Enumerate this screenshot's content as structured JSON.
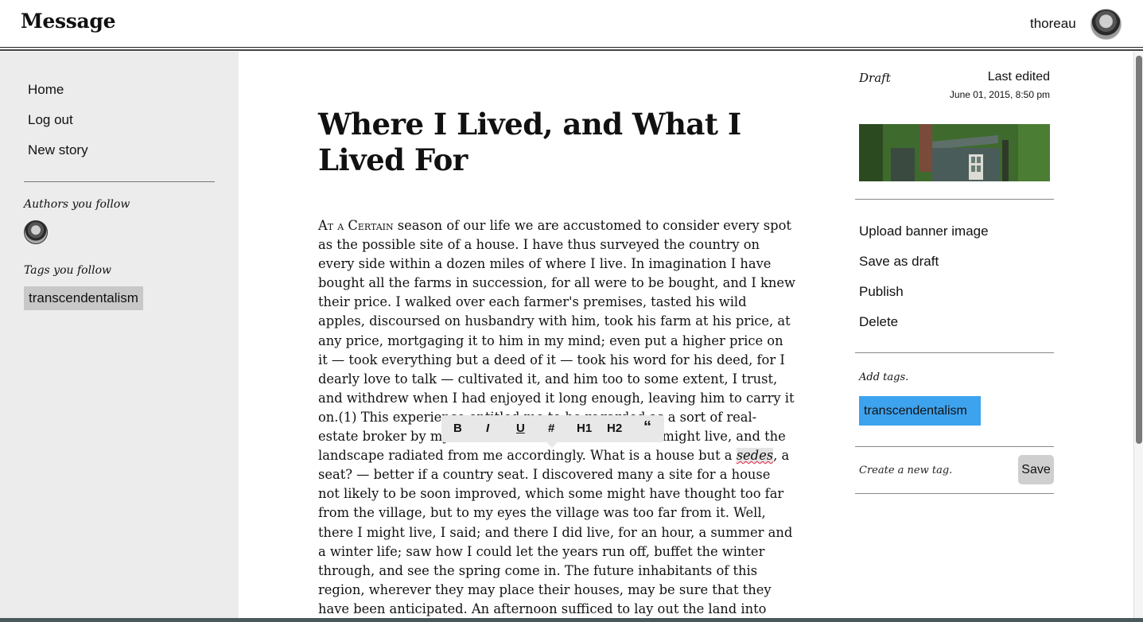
{
  "app": {
    "brand": "Message"
  },
  "user": {
    "name": "thoreau"
  },
  "sidebar": {
    "nav": [
      {
        "label": "Home"
      },
      {
        "label": "Log out"
      },
      {
        "label": "New story"
      }
    ],
    "authors_heading": "Authors you follow",
    "tags_heading": "Tags you follow",
    "tags": [
      {
        "label": "transcendentalism"
      }
    ]
  },
  "article": {
    "title": "Where I Lived, and What I Lived For",
    "body_lead_smallcaps": "At a Certain",
    "body_part1": " season of our life we are accustomed to consider every spot as the possible site of a house. I have thus surveyed the country on every side within a dozen miles of where I live. In imagination I have bought all the farms in succession, for all were to be bought, and I knew their price. I walked over each farmer's premises, tasted his wild apples, discoursed on husbandry with him, took his farm at his price, at any price, mortgaging it to him in my mind; even put a higher price on it — took everything but a deed of it — took his word for his deed, for I dearly love to talk — cultivated it, and him too to some extent, I trust, and withdrew when I had enjoyed it long enough, leaving him to carry it on.(1) This experience entitled me to be regarded as a sort of real-estate broker by my friends. Wherever I sat, there I might live, and the landscape radiated from me accordingly. What is a house but a ",
    "body_italic": "sedes",
    "body_part2": ", a seat? — better if a country seat. I discovered many a site for a house not likely to be soon improved, which some might have thought too far from the village, but to my eyes the village was too far from it. Well, there I might live, I said; and there I did live, for an hour, a summer and a winter life; saw how I could let the years run off, buffet the winter through, and see the spring come in. The future inhabitants of this region, wherever they may place their houses, may be sure that they have been anticipated. An afternoon sufficed to lay out the land into orchard, wood-lot, and pasture, and to decide what fine oaks or"
  },
  "toolbar": {
    "bold": "B",
    "italic": "I",
    "underline": "U",
    "hash": "#",
    "h1": "H1",
    "h2": "H2",
    "quote": "“"
  },
  "panel": {
    "status": "Draft",
    "last_edited_label": "Last edited",
    "last_edited_date": "June 01, 2015, 8:50 pm",
    "actions": [
      {
        "label": "Upload banner image"
      },
      {
        "label": "Save as draft"
      },
      {
        "label": "Publish"
      },
      {
        "label": "Delete"
      }
    ],
    "add_tags_label": "Add tags.",
    "selected_tag": "transcendentalism",
    "new_tag_placeholder": "Create a new tag.",
    "save_label": "Save",
    "accent_color": "#3ea3ee"
  }
}
